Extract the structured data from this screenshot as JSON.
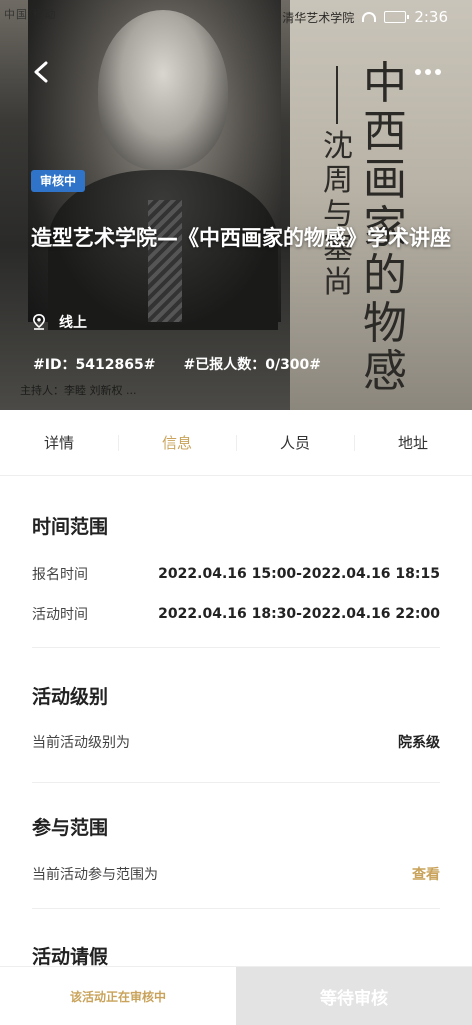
{
  "status_bar": {
    "carrier": "中国 移动",
    "overlay_text": "清华艺术学院",
    "time": "2:36"
  },
  "poster": {
    "calligraphy_main": [
      "中",
      "西",
      "画",
      "家",
      "的",
      "物",
      "感"
    ],
    "calligraphy_sub": [
      "沈",
      "周",
      "与",
      "塞",
      "尚"
    ],
    "caption": "主持人：李睦 刘新权 ..."
  },
  "hero": {
    "badge": "审核中",
    "title": "造型艺术学院—《中西画家的物感》学术讲座",
    "location": "线上",
    "event_id": "#ID：5412865#",
    "signup_count": "#已报人数：0/300#"
  },
  "tabs": [
    {
      "label": "详情"
    },
    {
      "label": "信息"
    },
    {
      "label": "人员"
    },
    {
      "label": "地址"
    }
  ],
  "info": {
    "time_range": {
      "title": "时间范围",
      "signup_label": "报名时间",
      "signup_value": "2022.04.16 15:00-2022.04.16 18:15",
      "activity_label": "活动时间",
      "activity_value": "2022.04.16 18:30-2022.04.16 22:00"
    },
    "level": {
      "title": "活动级别",
      "label": "当前活动级别为",
      "value": "院系级"
    },
    "scope": {
      "title": "参与范围",
      "label": "当前活动参与范围为",
      "link": "查看"
    },
    "leave": {
      "title": "活动请假"
    }
  },
  "bottom": {
    "status_text": "该活动正在审核中",
    "button_label": "等待审核"
  },
  "colors": {
    "accent_gold": "#c9a35b",
    "badge_blue": "#2f74c8",
    "disabled_gray": "#e3e3e3"
  }
}
